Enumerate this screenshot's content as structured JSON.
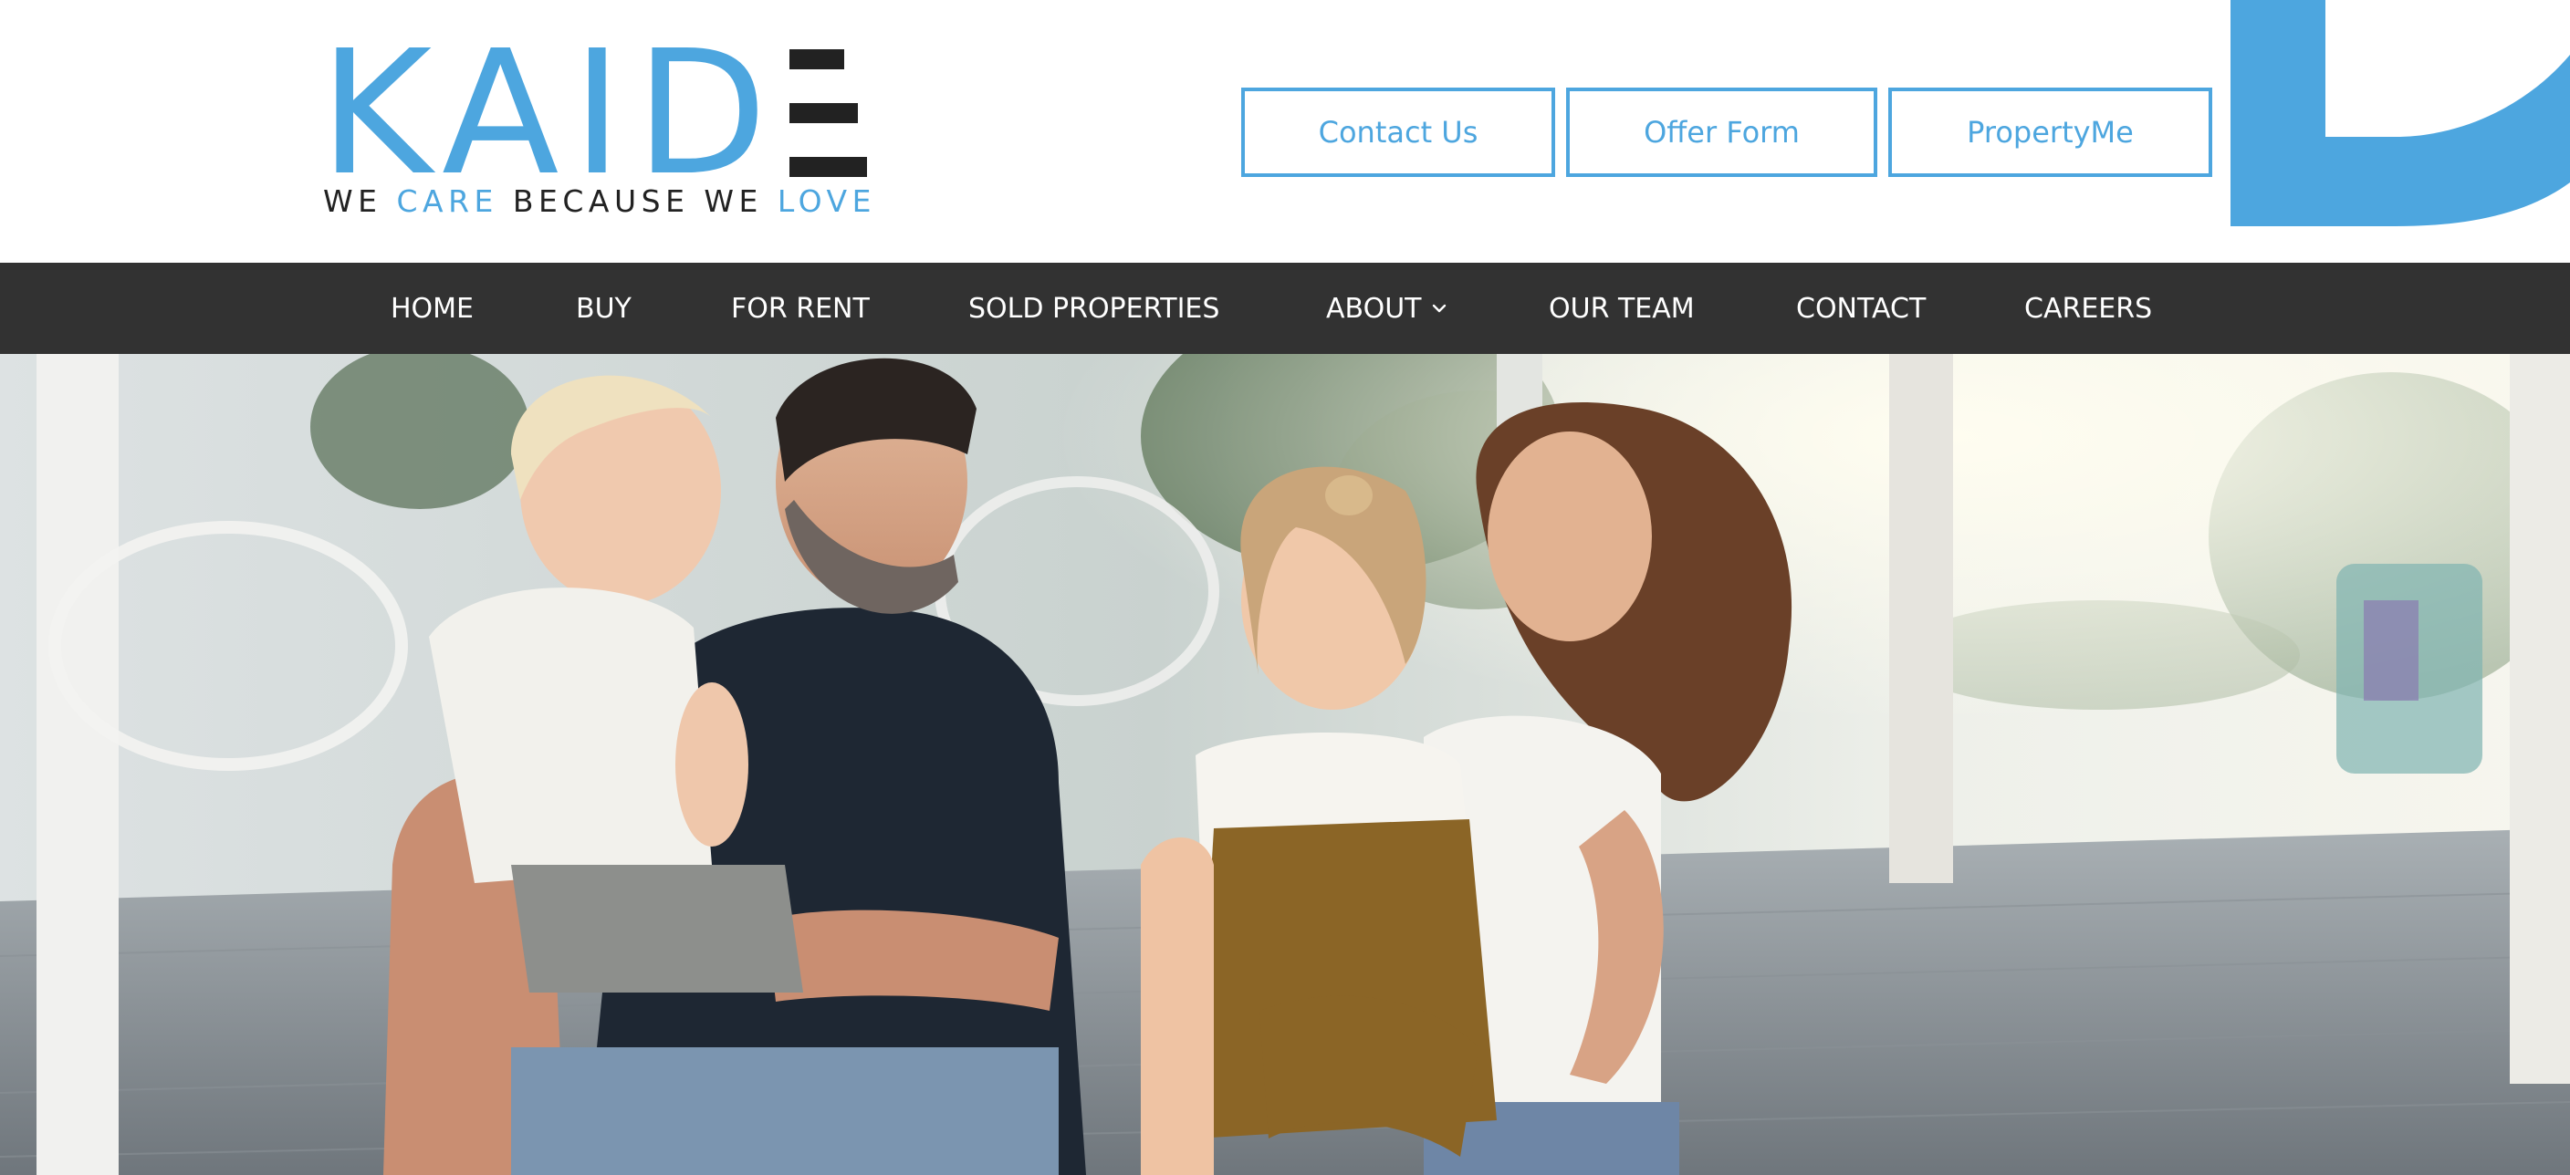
{
  "brand": {
    "logo_text": "KAID",
    "logo_alt": "KAIDE",
    "tagline_parts": [
      "WE ",
      "CARE",
      " BECAUSE WE ",
      "LOVE"
    ],
    "color_primary": "#4da6df",
    "color_dark": "#222222"
  },
  "header_buttons": [
    {
      "label": "Contact Us"
    },
    {
      "label": "Offer Form"
    },
    {
      "label": "PropertyMe"
    }
  ],
  "nav": {
    "items": [
      {
        "label": "HOME"
      },
      {
        "label": "BUY"
      },
      {
        "label": "FOR RENT"
      },
      {
        "label": "SOLD PROPERTIES"
      },
      {
        "label": "ABOUT",
        "has_dropdown": true,
        "icon": "chevron-down-icon"
      },
      {
        "label": "OUR TEAM"
      },
      {
        "label": "CONTACT"
      },
      {
        "label": "CAREERS"
      }
    ],
    "background": "#323232"
  },
  "hero": {
    "image_subject": "family-photo"
  }
}
